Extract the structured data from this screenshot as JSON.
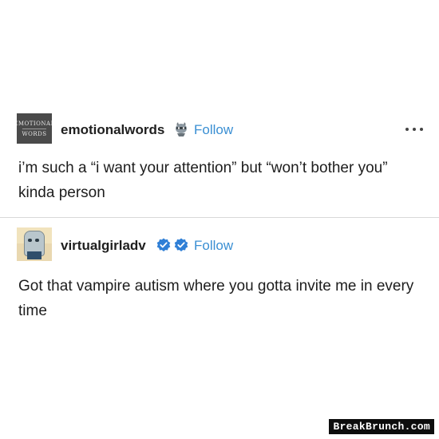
{
  "posts": [
    {
      "username": "emotionalwords",
      "avatar_text": [
        "EMOTIONAL",
        "WORDS"
      ],
      "follow_label": "Follow",
      "text": "i’m such a “i want your attention” but “won’t bother you” kinda person",
      "icons": [
        "avatar",
        "raccoon-emoji-icon",
        "more-options-icon"
      ]
    },
    {
      "username": "virtualgirladv",
      "follow_label": "Follow",
      "text": "Got that vampire autism where you gotta invite me in every time",
      "icons": [
        "avatar",
        "verified-badge-icon",
        "verified-badge-icon"
      ]
    }
  ],
  "watermark": "BreakBrunch.com",
  "colors": {
    "follow": "#3a8fd3",
    "badge": "#2f7fd6",
    "divider": "#d8d8d8"
  }
}
